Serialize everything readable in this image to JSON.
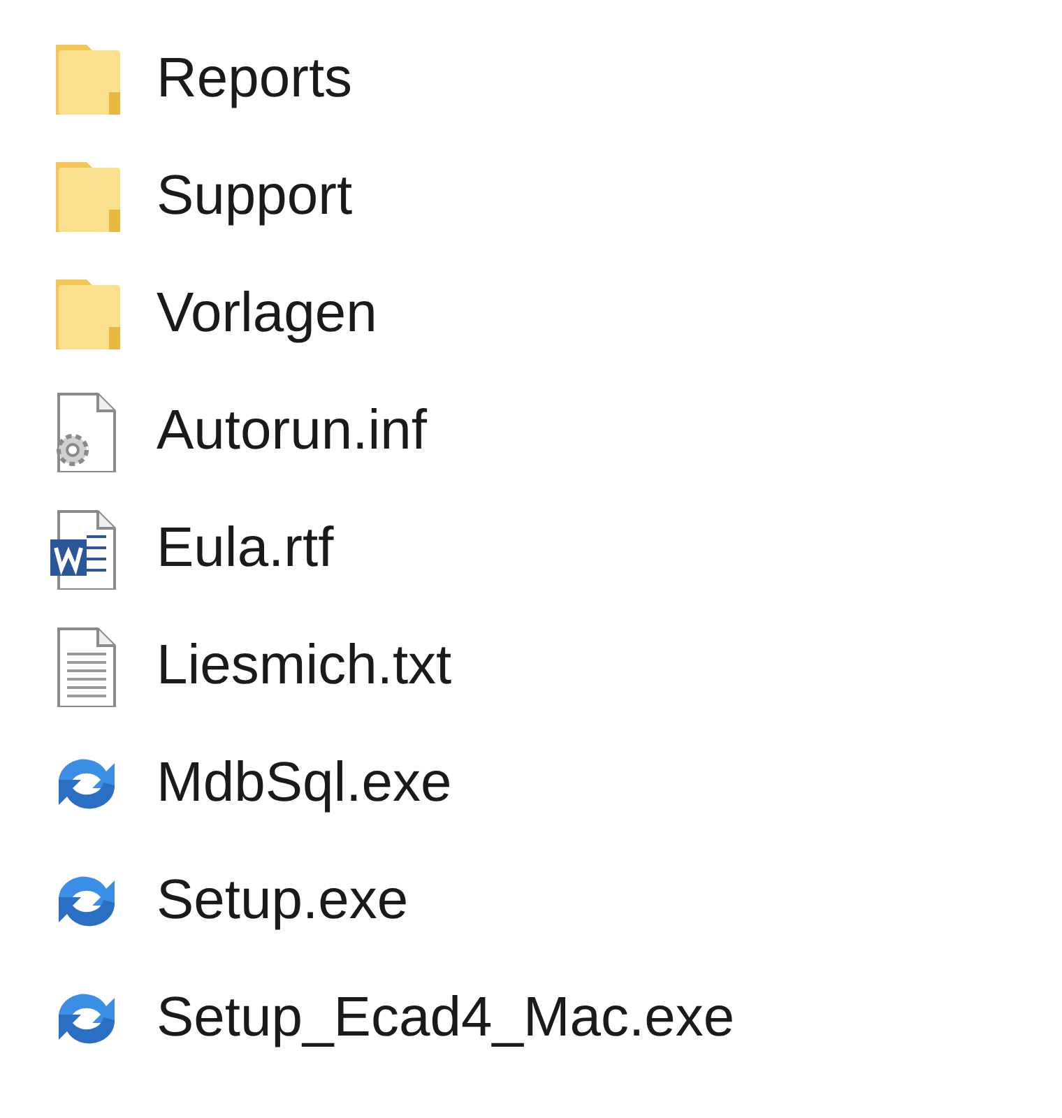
{
  "files": [
    {
      "name": "Reports",
      "kind": "folder"
    },
    {
      "name": "Support",
      "kind": "folder"
    },
    {
      "name": "Vorlagen",
      "kind": "folder"
    },
    {
      "name": "Autorun.inf",
      "kind": "settings"
    },
    {
      "name": "Eula.rtf",
      "kind": "word"
    },
    {
      "name": "Liesmich.txt",
      "kind": "text"
    },
    {
      "name": "MdbSql.exe",
      "kind": "exe"
    },
    {
      "name": "Setup.exe",
      "kind": "exe"
    },
    {
      "name": "Setup_Ecad4_Mac.exe",
      "kind": "exe"
    }
  ]
}
